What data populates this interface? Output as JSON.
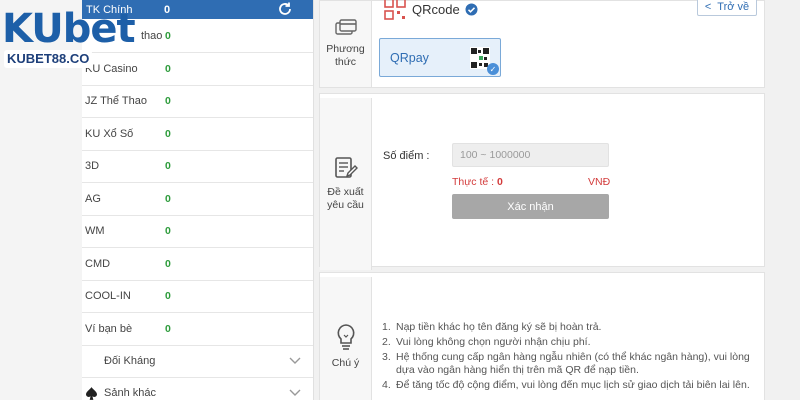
{
  "logo": {
    "ku": "KU",
    "bet": "bet",
    "domain": "KUBET88.CO"
  },
  "balances": {
    "header": {
      "label": "TK Chính",
      "value": "0"
    },
    "rows": [
      {
        "label": "thao",
        "value": "0"
      },
      {
        "label": "KU Casino",
        "value": "0"
      },
      {
        "label": "JZ Thể Thao",
        "value": "0"
      },
      {
        "label": "KU Xổ Số",
        "value": "0"
      },
      {
        "label": "3D",
        "value": "0"
      },
      {
        "label": "AG",
        "value": "0"
      },
      {
        "label": "WM",
        "value": "0"
      },
      {
        "label": "CMD",
        "value": "0"
      },
      {
        "label": "COOL-IN",
        "value": "0"
      },
      {
        "label": "Ví bạn bè",
        "value": "0"
      }
    ],
    "groups": [
      {
        "label": "Đối Kháng"
      },
      {
        "label": "Sảnh khác"
      }
    ]
  },
  "method": {
    "side_label": "Phương thức",
    "title": "QRcode",
    "back_label": "Trở về",
    "option_label": "QRpay"
  },
  "proposal": {
    "side_label": "Đề xuất yêu cầu",
    "points_label": "Số điểm :",
    "points_placeholder": "100 ~ 1000000",
    "actual_label": "Thực tế :",
    "actual_value": "0",
    "currency": "VNĐ",
    "confirm_label": "Xác nhận"
  },
  "notes": {
    "side_label": "Chú ý",
    "items": [
      {
        "num": "1.",
        "text": "Nạp tiền khác họ tên đăng ký sẽ bị hoàn trả."
      },
      {
        "num": "2.",
        "text": "Vui lòng không chọn người nhận chịu phí."
      },
      {
        "num": "3.",
        "text": "Hệ thống cung cấp ngân hàng ngẫu nhiên (có thể khác ngân hàng), vui lòng dựa vào ngân hàng hiển thị trên mã QR để nạp tiền."
      },
      {
        "num": "4.",
        "text": "Để tăng tốc độ cộng điểm, vui lòng đến mục lịch sử giao dịch tải biên lai lên."
      }
    ]
  },
  "colors": {
    "brand": "#2f6db3",
    "positive": "#2e9c3c",
    "alert": "#d33b3b",
    "disabled": "#a7a7a7"
  }
}
